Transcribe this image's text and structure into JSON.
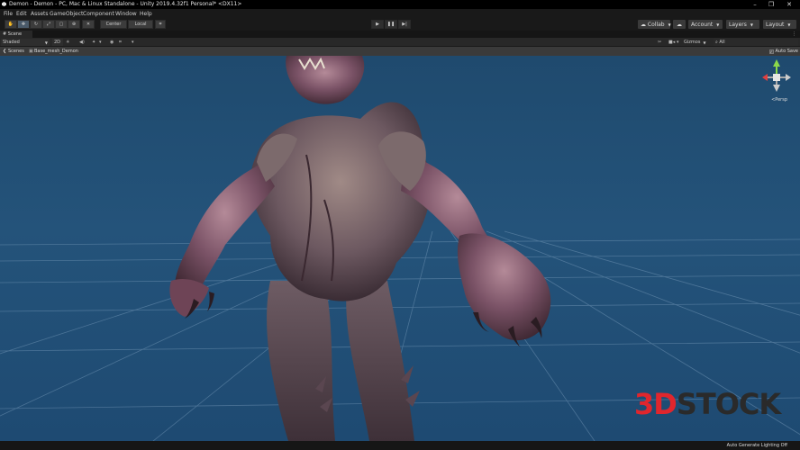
{
  "window": {
    "title": "Demon - Demon - PC, Mac & Linux Standalone - Unity 2019.4.32f1 Personal* <DX11>",
    "controls": [
      "–",
      "❐",
      "✕"
    ]
  },
  "menu": [
    "File",
    "Edit",
    "Assets",
    "GameObject",
    "Component",
    "Window",
    "Help"
  ],
  "toolbar": {
    "pivot_label": "Center",
    "space_label": "Local",
    "collab_label": "Collab",
    "account_label": "Account",
    "layers_label": "Layers",
    "layout_label": "Layout"
  },
  "tabs": {
    "scene": "Scene"
  },
  "scene_toolbar": {
    "draw_mode": "Shaded",
    "mode_2d": "2D",
    "gizmos_label": "Gizmos",
    "search_label": "All"
  },
  "breadcrumbs": {
    "scenes": "Scenes",
    "object": "Base_mesh_Demon"
  },
  "auto_save": {
    "label": "Auto Save",
    "checked": true
  },
  "viewport": {
    "persp_label": "<Persp"
  },
  "watermark": {
    "part1": "3D",
    "part2": "STOCK"
  },
  "status": {
    "lighting": "Auto Generate Lighting Off"
  },
  "colors": {
    "sky": "#24537a",
    "grid": "#6f93b3",
    "accent": "#e0262d"
  }
}
